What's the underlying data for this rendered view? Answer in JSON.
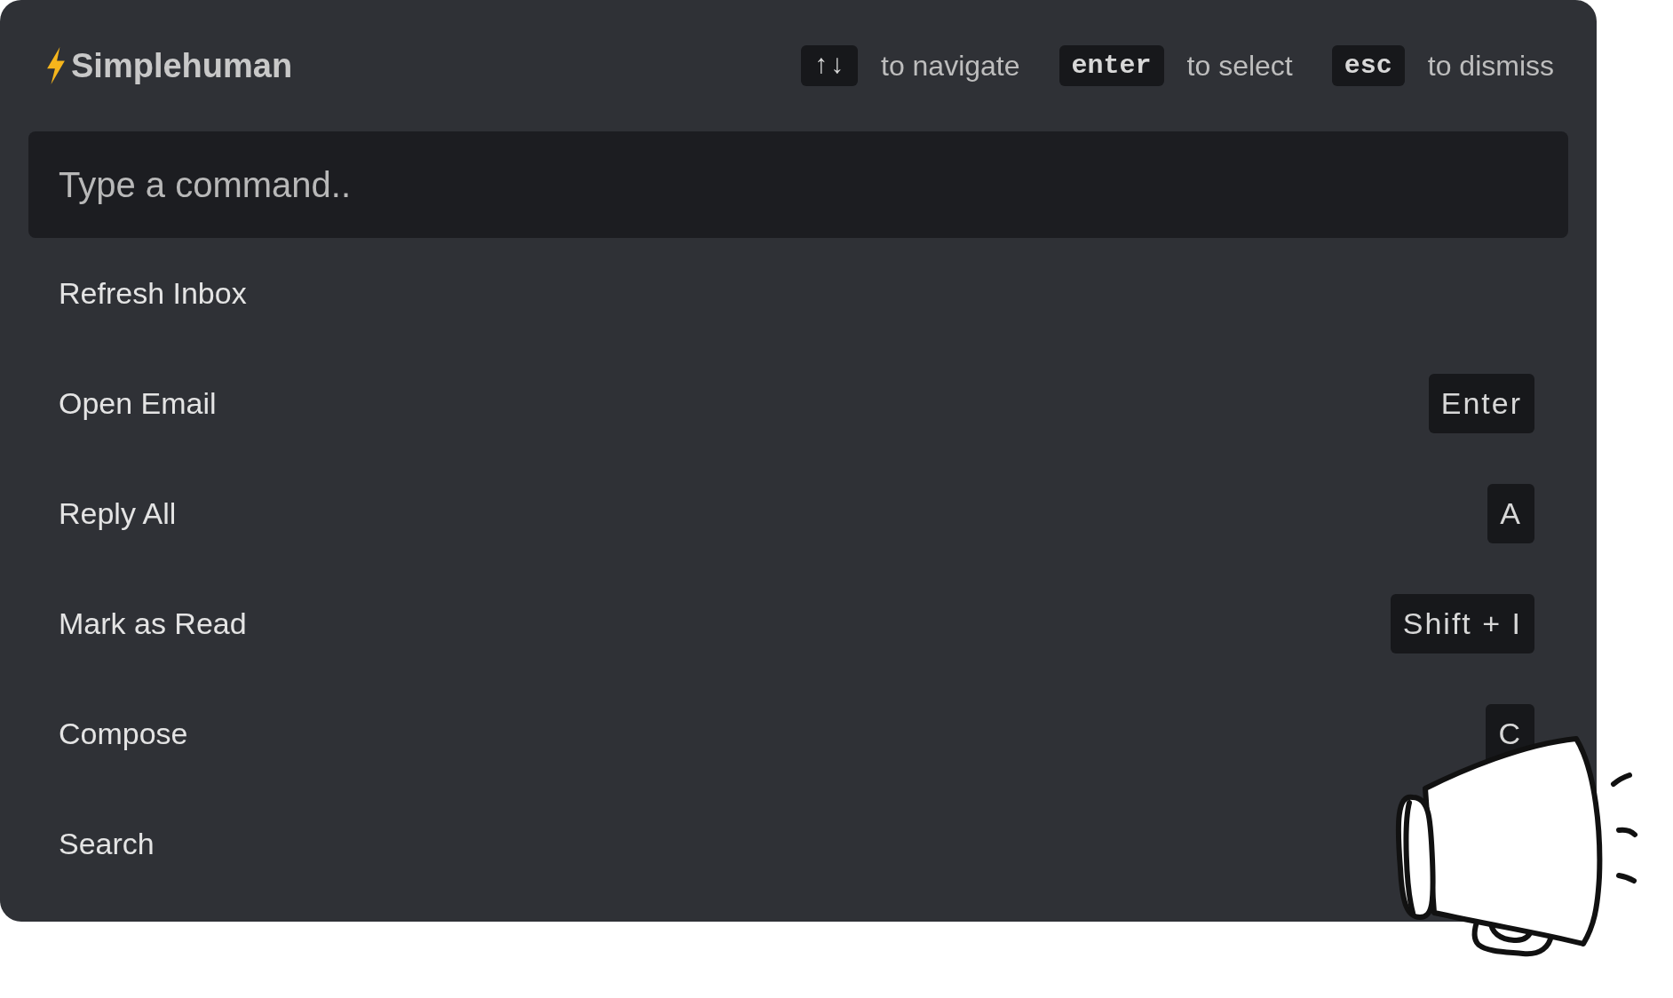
{
  "palette": {
    "title": "Simplehuman",
    "hints": [
      {
        "key": "↑↓",
        "label": "to navigate"
      },
      {
        "key": "enter",
        "label": "to select"
      },
      {
        "key": "esc",
        "label": "to dismiss"
      }
    ],
    "search": {
      "placeholder": "Type a command.."
    },
    "commands": [
      {
        "label": "Refresh Inbox"
      },
      {
        "label": "Open Email",
        "shortcut": "Enter"
      },
      {
        "label": "Reply All",
        "shortcut": "A"
      },
      {
        "label": "Mark as Read",
        "shortcut": "Shift + I"
      },
      {
        "label": "Compose",
        "shortcut": "C"
      },
      {
        "label": "Search"
      }
    ]
  }
}
